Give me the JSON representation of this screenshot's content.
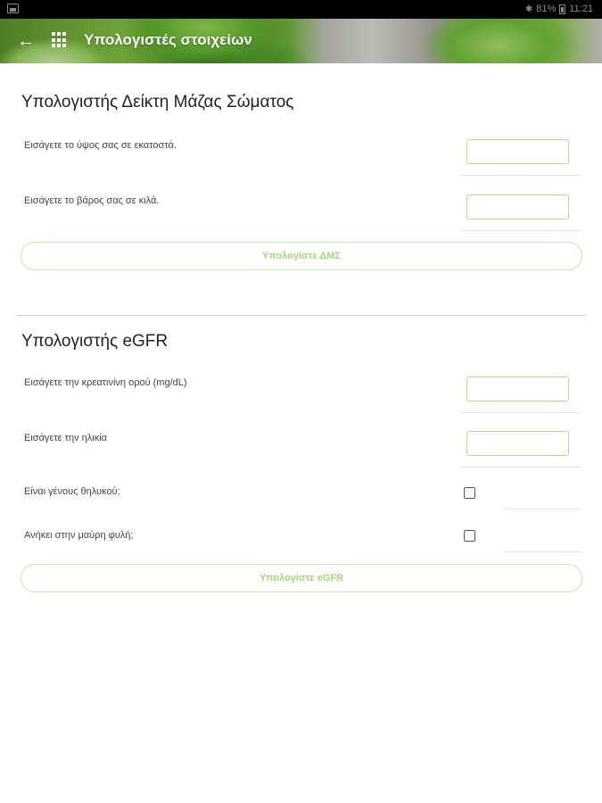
{
  "status_bar": {
    "battery": "81%",
    "time": "11:21"
  },
  "app_bar": {
    "title": "Υπολογιστές στοιχείων",
    "back_icon": "arrow-left-icon",
    "menu_icon": "grid-icon"
  },
  "bmi": {
    "title": "Υπολογιστής Δείκτη Μάζας Σώματος",
    "height_label": "Εισάγετε το ύψος σας σε εκατοστά.",
    "height_value": "",
    "weight_label": "Εισάγετε το βάρος σας σε κιλά.",
    "weight_value": "",
    "button_label": "Υπολογίστε ΔΜΣ"
  },
  "egfr": {
    "title": "Υπολογιστής eGFR",
    "creatinine_label": "Εισάγετε την κρεατινίνη ορού (mg/dL)",
    "creatinine_value": "",
    "age_label": "Εισάγετε την ηλικία",
    "age_value": "",
    "female_label": "Είναι γένους θηλυκού;",
    "female_checked": false,
    "black_label": "Ανήκει στην μαύρη φυλή;",
    "black_checked": false,
    "button_label": "Υπολογίστε eGFR"
  },
  "colors": {
    "accent": "#b6dd8a",
    "button_text": "#a6d479"
  }
}
